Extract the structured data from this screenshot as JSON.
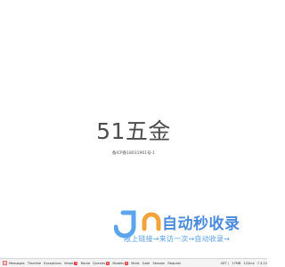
{
  "site": {
    "title": "51五金",
    "icp": "备ICP备18031961号-1"
  },
  "promo": {
    "logo_text": "自动秒收录",
    "tagline": "敞上链接→来访一次→自动收录→"
  },
  "debugbar": {
    "tabs": [
      {
        "label": "Messages"
      },
      {
        "label": "Timeline"
      },
      {
        "label": "Exceptions"
      },
      {
        "label": "Views",
        "count": "3"
      },
      {
        "label": "Route"
      },
      {
        "label": "Queries",
        "count": "0"
      },
      {
        "label": "Models",
        "count": "0"
      },
      {
        "label": "Mails"
      },
      {
        "label": "Gate"
      },
      {
        "label": "Session"
      },
      {
        "label": "Request"
      }
    ],
    "method": "GET /",
    "memory": "17MB",
    "time": "122ms",
    "php": "7.3.22",
    "colors": {
      "badge": "#e0393e"
    }
  }
}
